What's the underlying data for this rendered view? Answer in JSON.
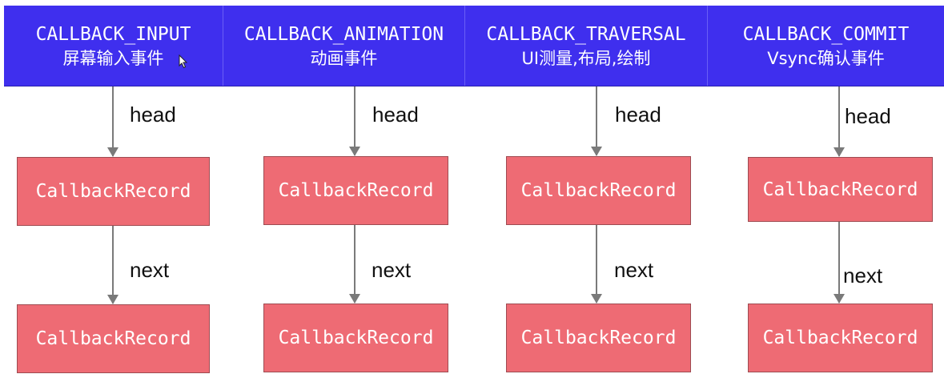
{
  "columns": [
    {
      "name": "CALLBACK_INPUT",
      "desc": "屏幕输入事件",
      "head_label": "head",
      "next_label": "next",
      "records": [
        "CallbackRecord",
        "CallbackRecord"
      ]
    },
    {
      "name": "CALLBACK_ANIMATION",
      "desc": "动画事件",
      "head_label": "head",
      "next_label": "next",
      "records": [
        "CallbackRecord",
        "CallbackRecord"
      ]
    },
    {
      "name": "CALLBACK_TRAVERSAL",
      "desc": "UI测量,布局,绘制",
      "head_label": "head",
      "next_label": "next",
      "records": [
        "CallbackRecord",
        "CallbackRecord"
      ]
    },
    {
      "name": "CALLBACK_COMMIT",
      "desc": "Vsync确认事件",
      "head_label": "head",
      "next_label": "next",
      "records": [
        "CallbackRecord",
        "CallbackRecord"
      ]
    }
  ],
  "colors": {
    "header": "#3f2fee",
    "record": "#ee6b74",
    "arrow": "#7a7a7a"
  },
  "icons": {
    "cursor": "mouse-pointer-icon"
  }
}
